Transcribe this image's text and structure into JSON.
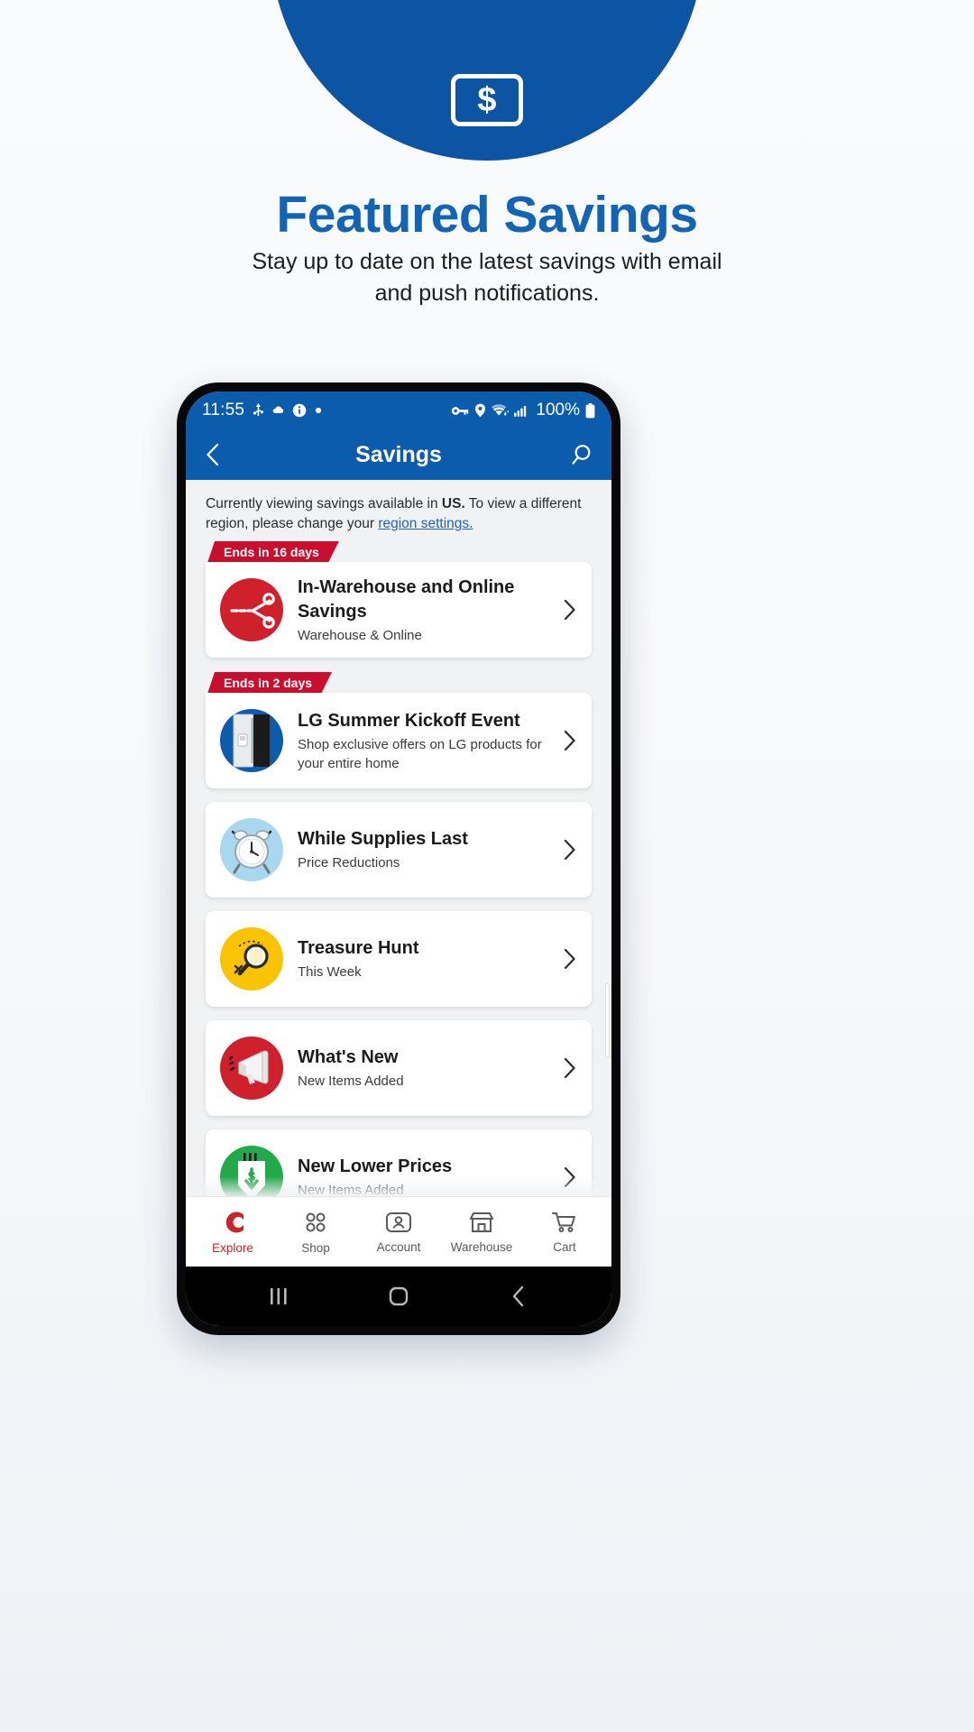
{
  "hero": {
    "logo_glyph": "$",
    "title": "Featured Savings",
    "subtitle": "Stay up to date on the latest savings with email and push notifications."
  },
  "phone": {
    "status_bar": {
      "time": "11:55",
      "battery_percent": "100%",
      "left_icons": [
        "usb-icon",
        "cloud-icon",
        "info-icon",
        "dot-icon"
      ],
      "right_icons": [
        "vpn-key-icon",
        "location-icon",
        "wifi-icon",
        "signal-icon",
        "battery-icon"
      ]
    },
    "app_bar": {
      "back_icon": "chevron-left-icon",
      "title": "Savings",
      "search_icon": "search-icon"
    },
    "region_note": {
      "prefix": "Currently viewing savings available in ",
      "region": "US.",
      "middle": " To view a different region, please change your ",
      "link": "region settings."
    },
    "cards": [
      {
        "ribbon": "Ends in 16 days",
        "title": "In-Warehouse and Online Savings",
        "subtitle": "Warehouse & Online",
        "icon": "scissors-coupon-icon",
        "icon_bg": "#d0202c",
        "chevron": "chevron-right-icon"
      },
      {
        "ribbon": "Ends in 2 days",
        "title": "LG Summer Kickoff Event",
        "subtitle": "Shop exclusive offers on LG products for your entire home",
        "icon": "refrigerator-icon",
        "icon_bg": "#0b5cad",
        "chevron": "chevron-right-icon"
      },
      {
        "ribbon": "",
        "title": "While Supplies Last",
        "subtitle": "Price Reductions",
        "icon": "alarm-clock-icon",
        "icon_bg": "#a7d8ef",
        "chevron": "chevron-right-icon"
      },
      {
        "ribbon": "",
        "title": "Treasure Hunt",
        "subtitle": "This Week",
        "icon": "magnifying-glass-icon",
        "icon_bg": "#fbc400",
        "chevron": "chevron-right-icon"
      },
      {
        "ribbon": "",
        "title": "What's New",
        "subtitle": "New Items Added",
        "icon": "megaphone-icon",
        "icon_bg": "#d0202c",
        "chevron": "chevron-right-icon"
      },
      {
        "ribbon": "",
        "title": "New Lower Prices",
        "subtitle": "New Items Added",
        "icon": "price-tag-down-icon",
        "icon_bg": "#22a94a",
        "chevron": "chevron-right-icon"
      }
    ],
    "bottom_nav": [
      {
        "label": "Explore",
        "icon": "costco-c-icon",
        "active": true
      },
      {
        "label": "Shop",
        "icon": "grid-dots-icon",
        "active": false
      },
      {
        "label": "Account",
        "icon": "person-card-icon",
        "active": false
      },
      {
        "label": "Warehouse",
        "icon": "store-icon",
        "active": false
      },
      {
        "label": "Cart",
        "icon": "cart-icon",
        "active": false
      }
    ],
    "android_nav": [
      {
        "icon": "recents-icon"
      },
      {
        "icon": "home-icon"
      },
      {
        "icon": "back-icon"
      }
    ]
  },
  "colors": {
    "brand_blue": "#0b5cad",
    "hero_blue": "#1265b5",
    "ribbon_red": "#c8102e",
    "active_red": "#cc2229"
  }
}
